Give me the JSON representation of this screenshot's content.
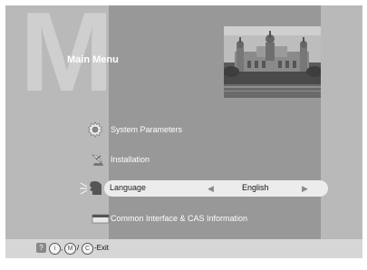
{
  "menu": {
    "big_letter": "M",
    "title": "Main Menu"
  },
  "items": [
    {
      "label": "System Parameters",
      "icon": "gear-icon"
    },
    {
      "label": "Installation",
      "icon": "satellite-dish-icon"
    },
    {
      "label": "Language",
      "icon": "speaking-head-icon",
      "value": "English",
      "selected": true
    },
    {
      "label": "Common Interface & CAS Information",
      "icon": "smart-card-icon"
    }
  ],
  "footer": {
    "help_glyph": "?",
    "btn1_glyph": "i",
    "btn2_glyph": "M",
    "btn3_glyph": "C",
    "sep1": ",",
    "sep2": "/",
    "exit_text": "-Exit"
  },
  "colors": {
    "panel_light": "#b9b9b9",
    "panel_dark": "#989898",
    "selection": "#ececec",
    "footer": "#d6d6d6"
  }
}
